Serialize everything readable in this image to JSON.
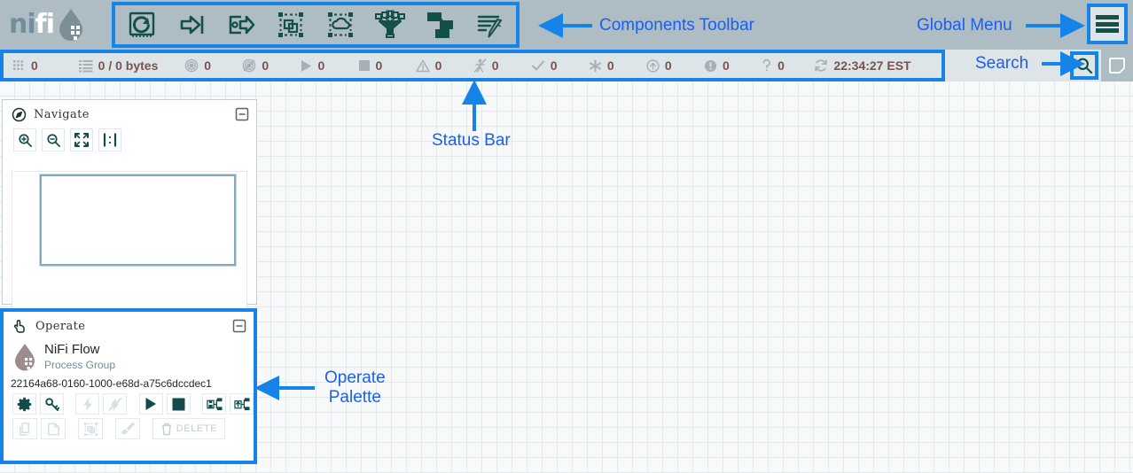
{
  "app": {
    "logo_dark": "ni",
    "logo_light": "fi",
    "logo_alt": "nifi"
  },
  "toolbar": {
    "items": [
      {
        "name": "processor",
        "label": "Processor"
      },
      {
        "name": "input-port",
        "label": "Input Port"
      },
      {
        "name": "output-port",
        "label": "Output Port"
      },
      {
        "name": "process-group",
        "label": "Process Group"
      },
      {
        "name": "remote-process-group",
        "label": "Remote Process Group"
      },
      {
        "name": "funnel",
        "label": "Funnel"
      },
      {
        "name": "template",
        "label": "Template"
      },
      {
        "name": "label",
        "label": "Label"
      }
    ]
  },
  "global_menu": {
    "label": "Global Menu"
  },
  "status_bar": {
    "items": [
      {
        "icon": "active-threads-icon",
        "value": "0"
      },
      {
        "icon": "queued-flowfiles-icon",
        "value": "0 / 0 bytes"
      },
      {
        "icon": "transmitting-icon",
        "value": "0"
      },
      {
        "icon": "not-transmitting-icon",
        "value": "0"
      },
      {
        "icon": "running-icon",
        "value": "0"
      },
      {
        "icon": "stopped-icon",
        "value": "0"
      },
      {
        "icon": "invalid-icon",
        "value": "0"
      },
      {
        "icon": "disabled-icon",
        "value": "0"
      },
      {
        "icon": "up-to-date-icon",
        "value": "0"
      },
      {
        "icon": "locally-modified-icon",
        "value": "0"
      },
      {
        "icon": "stale-icon",
        "value": "0"
      },
      {
        "icon": "sync-failure-icon",
        "value": "0"
      },
      {
        "icon": "unknown-version-icon",
        "value": "0"
      },
      {
        "icon": "refresh-icon",
        "value": "22:34:27 EST"
      }
    ]
  },
  "search": {
    "label": "Search",
    "placeholder": "Search"
  },
  "navigate": {
    "title": "Navigate",
    "buttons": [
      {
        "name": "zoom-in-icon"
      },
      {
        "name": "zoom-out-icon"
      },
      {
        "name": "zoom-fit-icon"
      },
      {
        "name": "zoom-actual-size-icon"
      }
    ]
  },
  "operate": {
    "title": "Operate",
    "component_name": "NiFi Flow",
    "component_type": "Process Group",
    "component_id": "22164a68-0160-1000-e68d-a75c6dccdec1",
    "row1": [
      {
        "name": "configure-button",
        "enabled": true
      },
      {
        "name": "view-details-button",
        "enabled": true
      },
      {
        "name": "enable-button",
        "enabled": false
      },
      {
        "name": "disable-button",
        "enabled": false
      },
      {
        "name": "start-button",
        "enabled": true
      },
      {
        "name": "stop-button",
        "enabled": true
      },
      {
        "name": "enable-transmission-button",
        "enabled": true
      },
      {
        "name": "disable-transmission-button",
        "enabled": true
      }
    ],
    "row2": [
      {
        "name": "copy-button",
        "enabled": false
      },
      {
        "name": "paste-button",
        "enabled": false
      },
      {
        "name": "group-button",
        "enabled": false
      },
      {
        "name": "change-color-button",
        "enabled": false
      }
    ],
    "delete_label": "DELETE"
  },
  "annotations": {
    "components_toolbar": "Components Toolbar",
    "global_menu": "Global Menu",
    "search": "Search",
    "status_bar": "Status Bar",
    "operate_palette": "Operate\nPalette"
  },
  "colors": {
    "accent_blue": "#1683e8",
    "annotation_blue": "#1b5ef2",
    "header_gray": "#aebdc4",
    "statusbar_gray": "#dde5e9",
    "icon_teal": "#154f4a",
    "value_maroon": "#775351",
    "muted_gray": "#a5b1b7"
  }
}
